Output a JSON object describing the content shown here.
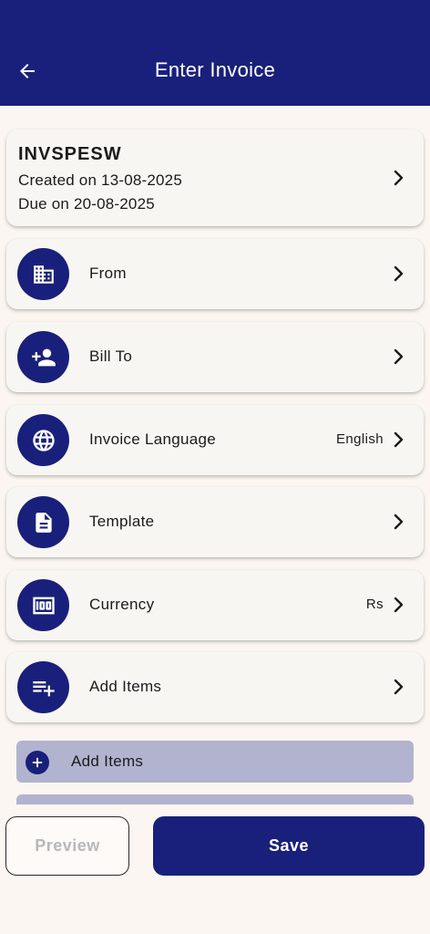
{
  "header": {
    "title": "Enter Invoice",
    "back_icon": "arrow-left-icon",
    "background": "#19207b"
  },
  "invoice": {
    "number": "INVSPESW",
    "created": "Created on 13-08-2025",
    "due": "Due on 20-08-2025"
  },
  "rows": [
    {
      "icon": "building-icon",
      "label": "From",
      "value": ""
    },
    {
      "icon": "add-person-icon",
      "label": "Bill To",
      "value": ""
    },
    {
      "icon": "globe-icon",
      "label": "Invoice Language",
      "value": "English"
    },
    {
      "icon": "document-icon",
      "label": "Template",
      "value": ""
    },
    {
      "icon": "money-icon",
      "label": "Currency",
      "value": "Rs"
    },
    {
      "icon": "playlist-add-icon",
      "label": "Add Items",
      "value": ""
    }
  ],
  "sub_item": {
    "icon": "plus-circle-icon",
    "label": "Add Items"
  },
  "footer": {
    "preview_label": "Preview",
    "save_label": "Save"
  },
  "colors": {
    "primary": "#19207b",
    "background": "#fbf6f1",
    "card": "#f8f6f2",
    "sub_item": "#b1b3cf",
    "disabled_text": "#b8b8b8"
  }
}
